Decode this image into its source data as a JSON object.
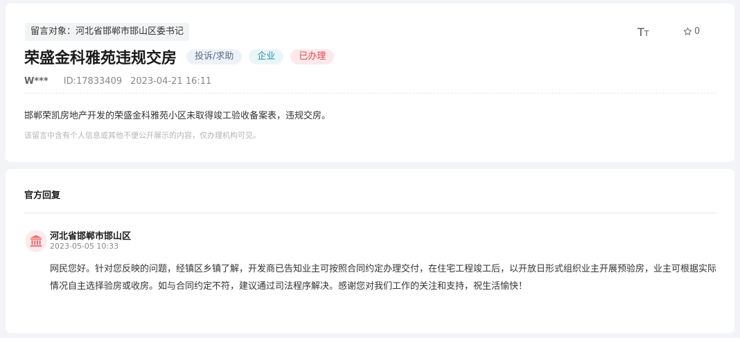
{
  "message": {
    "target_label": "留言对象：河北省邯郸市邯山区委书记",
    "title": "荣盛金科雅苑违规交房",
    "tags": {
      "type": "投诉/求助",
      "org": "企业",
      "status": "已办理"
    },
    "tools": {
      "font_big": "T",
      "font_small": "T",
      "favorite_count": "0"
    },
    "author": "W***",
    "id_text": "ID:17833409",
    "datetime": "2023-04-21 16:11",
    "content": "邯郸荣凯房地产开发的荣盛金科雅苑小区未取得竣工验收备案表，违规交房。",
    "privacy_note": "该留言中含有个人信息或其他不便公开展示的内容，仅办理机构可见。"
  },
  "reply": {
    "heading": "官方回复",
    "department": "河北省邯郸市邯山区",
    "datetime": "2023-05-05 10:33",
    "body": "网民您好。针对您反映的问题，经镇区乡镇了解，开发商已告知业主可按照合同约定办理交付，在住宅工程竣工后，以开放日形式组织业主开展预验房，业主可根据实际情况自主选择验房或收房。如与合同约定不符，建议通过司法程序解决。感谢您对我们工作的关注和支持，祝生活愉快！"
  },
  "colors": {
    "status_red": "#e0474f",
    "org_teal": "#2b8ea6",
    "type_slate": "#5a6b86",
    "avatar_red": "#e9686e"
  }
}
